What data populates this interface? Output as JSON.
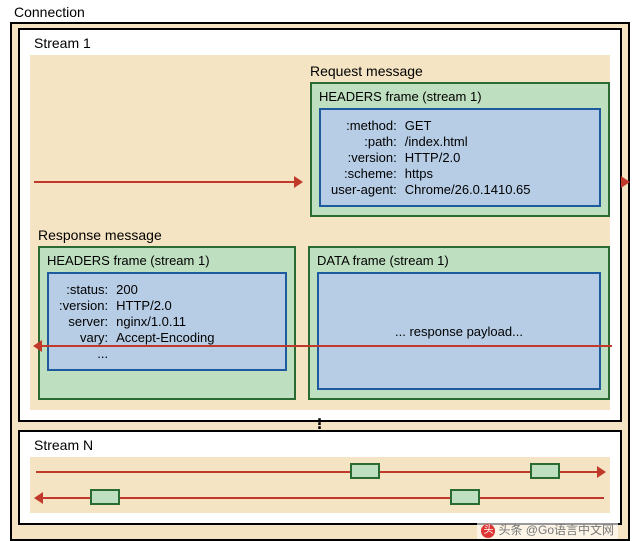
{
  "connection_label": "Connection",
  "stream1": {
    "title": "Stream 1",
    "request": {
      "label": "Request message",
      "headers_frame": {
        "title": "HEADERS frame (stream 1)",
        "fields": {
          "method_k": ":method:",
          "method_v": "GET",
          "path_k": ":path:",
          "path_v": "/index.html",
          "version_k": ":version:",
          "version_v": "HTTP/2.0",
          "scheme_k": ":scheme:",
          "scheme_v": "https",
          "ua_k": "user-agent:",
          "ua_v": "Chrome/26.0.1410.65"
        }
      }
    },
    "response": {
      "label": "Response message",
      "headers_frame": {
        "title": "HEADERS frame (stream 1)",
        "fields": {
          "status_k": ":status:",
          "status_v": "200",
          "version_k": ":version:",
          "version_v": "HTTP/2.0",
          "server_k": "server:",
          "server_v": "nginx/1.0.11",
          "vary_k": "vary:",
          "vary_v": "Accept-Encoding",
          "more_k": "...",
          "more_v": ""
        }
      },
      "data_frame": {
        "title": "DATA frame (stream 1)",
        "body": "... response payload..."
      }
    }
  },
  "streamN": {
    "title": "Stream N"
  },
  "watermark": {
    "prefix": "头条",
    "handle": "@Go语言中文网"
  }
}
